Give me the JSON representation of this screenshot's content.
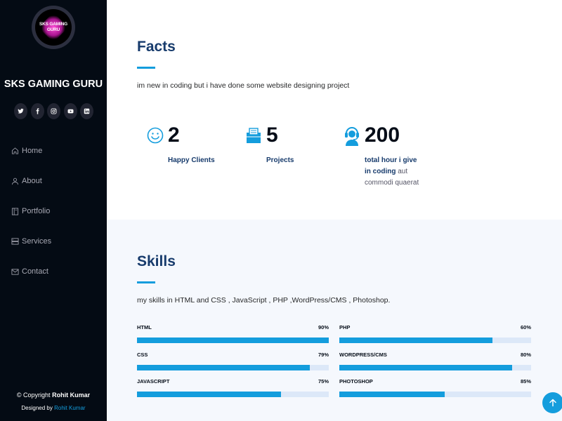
{
  "sidebar": {
    "avatar_text_line1": "SKS GAMING",
    "avatar_text_line2": "GURU",
    "brand": "SKS GAMING GURU",
    "socials": [
      {
        "name": "twitter-icon",
        "glyph": "t"
      },
      {
        "name": "facebook-icon",
        "glyph": "f"
      },
      {
        "name": "instagram-icon",
        "glyph": "◎"
      },
      {
        "name": "youtube-icon",
        "glyph": "▶"
      },
      {
        "name": "linkedin-icon",
        "glyph": "in"
      }
    ],
    "nav": [
      {
        "label": "Home",
        "icon": "home-icon"
      },
      {
        "label": "About",
        "icon": "user-icon"
      },
      {
        "label": "Portfolio",
        "icon": "book-icon"
      },
      {
        "label": "Services",
        "icon": "server-icon"
      },
      {
        "label": "Contact",
        "icon": "envelope-icon"
      }
    ],
    "footer": {
      "copyright_prefix": "© Copyright",
      "copyright_name": "Rohit Kumar",
      "designed_prefix": "Designed by",
      "designed_name": "Rohit Kumar"
    }
  },
  "facts": {
    "title": "Facts",
    "description": "im new in coding but i have done some website designing project",
    "counters": [
      {
        "value": "2",
        "label_bold": "Happy Clients",
        "label_rest": "",
        "icon": "smile-icon"
      },
      {
        "value": "5",
        "label_bold": "Projects",
        "label_rest": "",
        "icon": "journal-icon"
      },
      {
        "value": "200",
        "label_bold": "total hour i give in coding",
        "label_rest": "aut commodi quaerat",
        "icon": "headset-icon"
      }
    ]
  },
  "skills": {
    "title": "Skills",
    "description": "my skills in HTML and CSS , JavaScript , PHP ,WordPress/CMS , Photoshop.",
    "items": [
      {
        "name": "HTML",
        "percent_label": "90%",
        "value": 100
      },
      {
        "name": "PHP",
        "percent_label": "60%",
        "value": 80
      },
      {
        "name": "CSS",
        "percent_label": "79%",
        "value": 90
      },
      {
        "name": "WORDPRESS/CMS",
        "percent_label": "80%",
        "value": 90
      },
      {
        "name": "JAVASCRIPT",
        "percent_label": "75%",
        "value": 75
      },
      {
        "name": "PHOTOSHOP",
        "percent_label": "85%",
        "value": 55
      }
    ]
  },
  "colors": {
    "accent": "#149ddd",
    "sidebar_bg": "#040b14",
    "heading": "#173b6c"
  }
}
